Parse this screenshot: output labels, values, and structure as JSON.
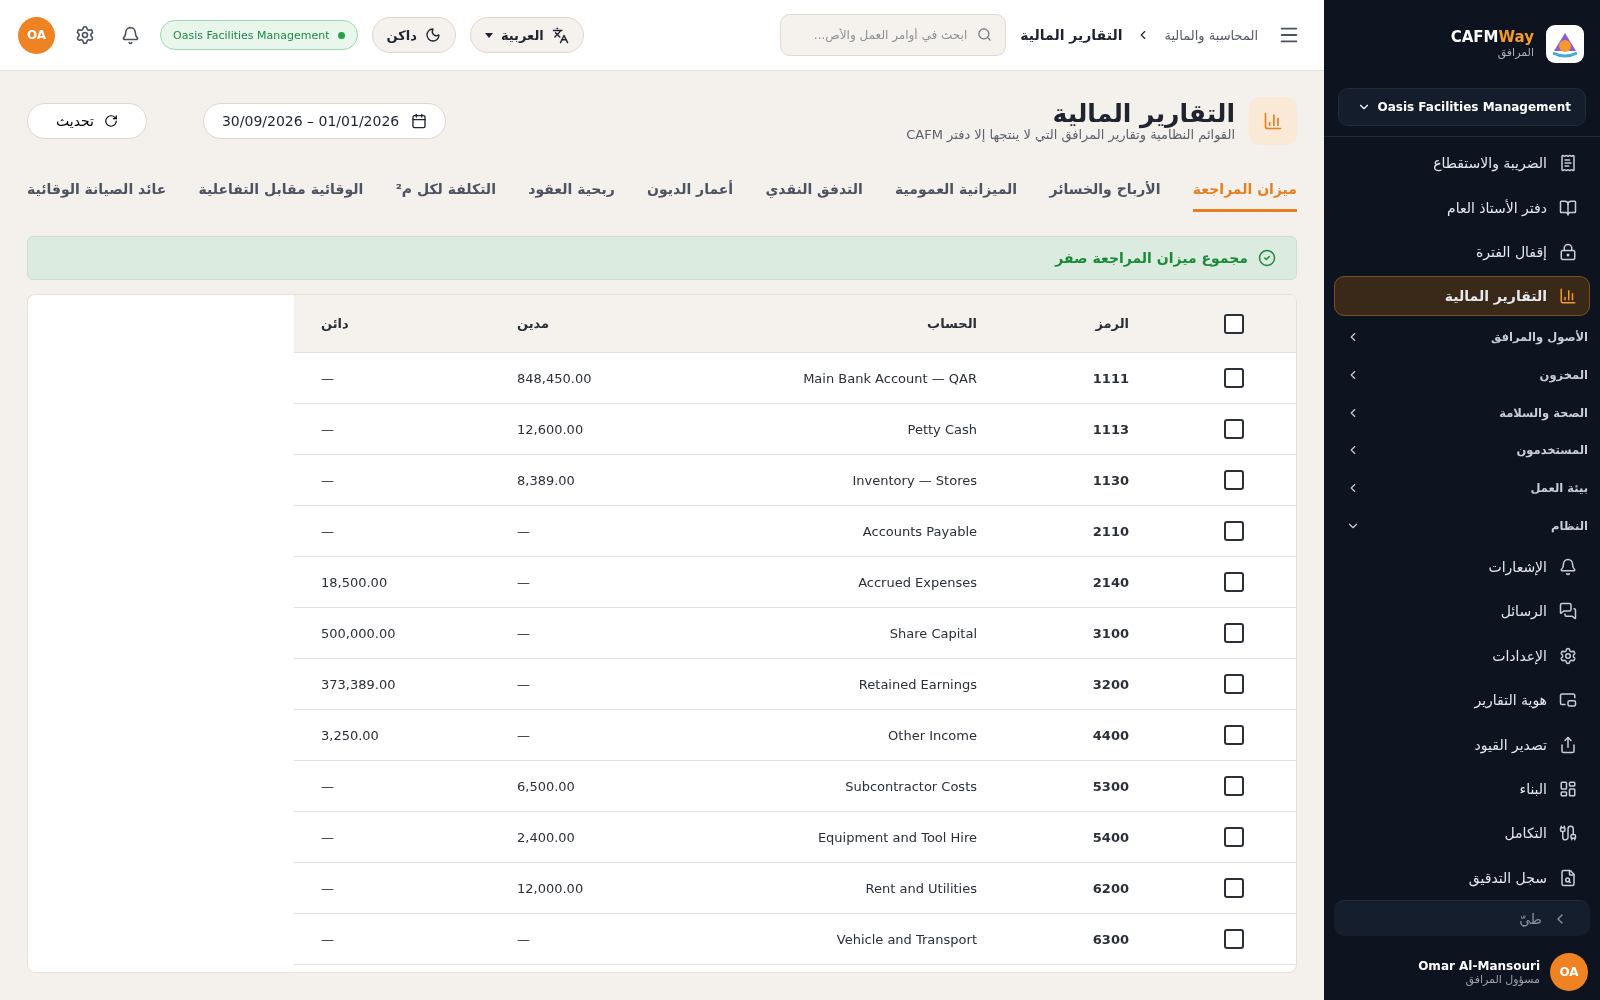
{
  "topbar": {
    "breadcrumb": [
      {
        "label": "المحاسبة والمالية",
        "current": false
      },
      {
        "label": "التقارير المالية",
        "current": true
      }
    ],
    "search": {
      "placeholder": "ابحث في أوامر العمل والأص..."
    },
    "language": "العربية",
    "theme": "داكن",
    "organization": "Oasis Facilities Management",
    "avatar": "OA"
  },
  "header": {
    "title": "التقارير المالية",
    "subtitle": "القوائم النظامية وتقارير المرافق التي لا ينتجها إلا دفتر CAFM",
    "date_range": "30/09/2026 – 01/01/2026",
    "refresh": "تحديث"
  },
  "tabs": [
    {
      "label": "ميزان المراجعة",
      "selected": true
    },
    {
      "label": "الأرباح والخسائر",
      "selected": false
    },
    {
      "label": "الميزانية العمومية",
      "selected": false
    },
    {
      "label": "التدفق النقدي",
      "selected": false
    },
    {
      "label": "أعمار الديون",
      "selected": false
    },
    {
      "label": "ربحية العقود",
      "selected": false
    },
    {
      "label": "التكلفة لكل م²",
      "selected": false
    },
    {
      "label": "الوقائية مقابل التفاعلية",
      "selected": false
    },
    {
      "label": "عائد الصيانة الوقائية",
      "selected": false
    }
  ],
  "banner": {
    "text": "مجموع ميزان المراجعة صفر"
  },
  "table": {
    "columns": [
      "الرمز",
      "الحساب",
      "مدين",
      "دائن"
    ],
    "header_checked": false,
    "rows": [
      {
        "checked": false,
        "code": "1111",
        "account": "Main Bank Account — QAR",
        "debit": "848,450.00",
        "credit": "—"
      },
      {
        "checked": false,
        "code": "1113",
        "account": "Petty Cash",
        "debit": "12,600.00",
        "credit": "—"
      },
      {
        "checked": false,
        "code": "1130",
        "account": "Inventory — Stores",
        "debit": "8,389.00",
        "credit": "—"
      },
      {
        "checked": false,
        "code": "2110",
        "account": "Accounts Payable",
        "debit": "—",
        "credit": "—"
      },
      {
        "checked": false,
        "code": "2140",
        "account": "Accrued Expenses",
        "debit": "—",
        "credit": "18,500.00"
      },
      {
        "checked": false,
        "code": "3100",
        "account": "Share Capital",
        "debit": "—",
        "credit": "500,000.00"
      },
      {
        "checked": false,
        "code": "3200",
        "account": "Retained Earnings",
        "debit": "—",
        "credit": "373,389.00"
      },
      {
        "checked": false,
        "code": "4400",
        "account": "Other Income",
        "debit": "—",
        "credit": "3,250.00"
      },
      {
        "checked": false,
        "code": "5300",
        "account": "Subcontractor Costs",
        "debit": "6,500.00",
        "credit": "—"
      },
      {
        "checked": false,
        "code": "5400",
        "account": "Equipment and Tool Hire",
        "debit": "2,400.00",
        "credit": "—"
      },
      {
        "checked": false,
        "code": "6200",
        "account": "Rent and Utilities",
        "debit": "12,000.00",
        "credit": "—"
      },
      {
        "checked": false,
        "code": "6300",
        "account": "Vehicle and Transport",
        "debit": "—",
        "credit": "—"
      }
    ]
  },
  "sidebar": {
    "brand": "CAFMWay",
    "brand_sub": "المرافق",
    "organization": "Oasis Facilities Management",
    "items": [
      {
        "kind": "link",
        "label": "الضريبة والاستقطاع",
        "selected": false
      },
      {
        "kind": "link",
        "label": "دفتر الأستاذ العام",
        "selected": false
      },
      {
        "kind": "link",
        "label": "إقفال الفترة",
        "selected": false
      },
      {
        "kind": "link",
        "label": "التقارير المالية",
        "selected": true
      },
      {
        "kind": "group",
        "label": "الأصول والمرافق",
        "expanded": false
      },
      {
        "kind": "group",
        "label": "المخزون",
        "expanded": false
      },
      {
        "kind": "group",
        "label": "الصحة والسلامة",
        "expanded": false
      },
      {
        "kind": "group",
        "label": "المستخدمون",
        "expanded": false
      },
      {
        "kind": "group",
        "label": "بيئة العمل",
        "expanded": false
      },
      {
        "kind": "group",
        "label": "النظام",
        "expanded": true,
        "children": [
          {
            "kind": "link",
            "label": "الإشعارات",
            "selected": false
          },
          {
            "kind": "link",
            "label": "الرسائل",
            "selected": false
          },
          {
            "kind": "link",
            "label": "الإعدادات",
            "selected": false
          },
          {
            "kind": "link",
            "label": "هوية التقارير",
            "selected": false
          },
          {
            "kind": "link",
            "label": "تصدير القيود",
            "selected": false
          },
          {
            "kind": "link",
            "label": "البناء",
            "selected": false
          },
          {
            "kind": "link",
            "label": "التكامل",
            "selected": false
          },
          {
            "kind": "link",
            "label": "سجل التدقيق",
            "selected": false
          }
        ]
      }
    ],
    "collapse": "طيّ",
    "user": {
      "name": "Omar Al-Mansouri",
      "role": "مسؤول المرافق",
      "initials": "OA"
    }
  }
}
